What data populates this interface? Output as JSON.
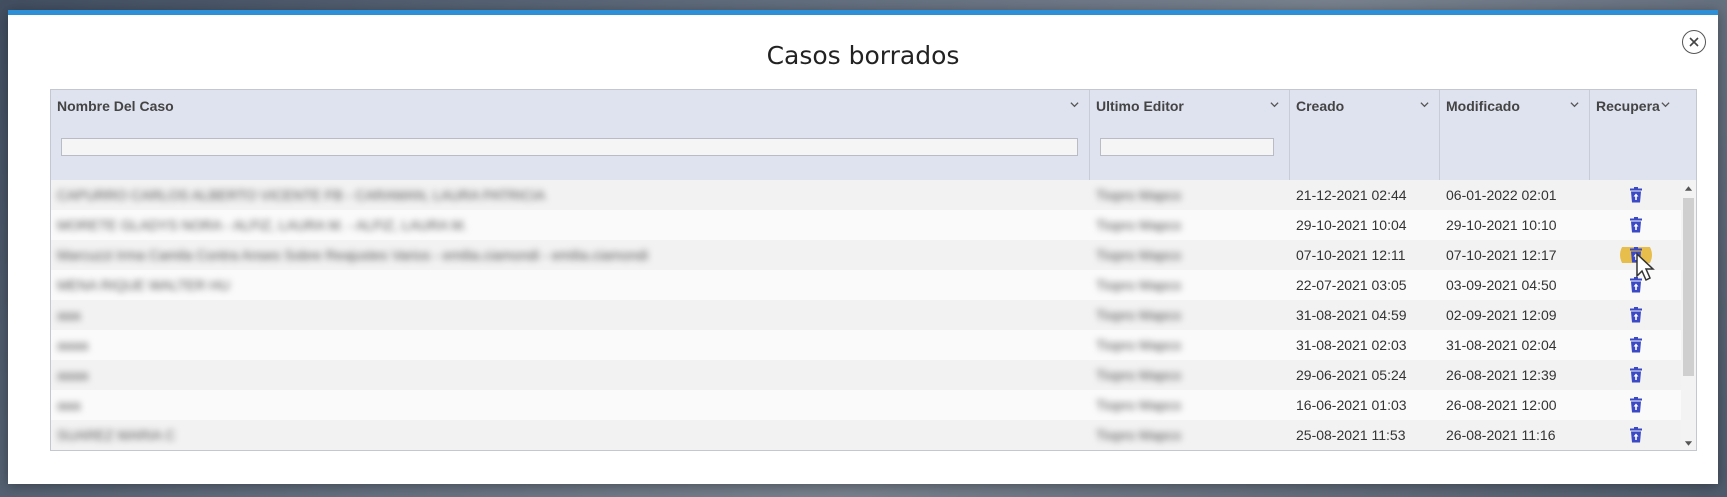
{
  "dialog": {
    "title": "Casos borrados"
  },
  "columns": [
    {
      "label": "Nombre Del Caso",
      "filter": ""
    },
    {
      "label": "Ultimo Editor",
      "filter": ""
    },
    {
      "label": "Creado"
    },
    {
      "label": "Modificado"
    },
    {
      "label": "Recupera"
    }
  ],
  "accent_color": "#2f8fd6",
  "restore_icon_color": "#3b49c4",
  "rows": [
    {
      "name": "CAPURRO CARLOS ALBERTO VICENTE FB - CARAMAN, LAURA PATRICIA",
      "editor": "Tiopro Mapco",
      "created": "21-12-2021 02:44",
      "modified": "06-01-2022 02:01",
      "hover": false
    },
    {
      "name": "MORETE GLADYS NORA - ALFIZ, LAURA M. - ALFIZ, LAURA M.",
      "editor": "Tiopro Mapco",
      "created": "29-10-2021 10:04",
      "modified": "29-10-2021 10:10",
      "hover": false
    },
    {
      "name": "Marcuzzi Irma Camila Contra Anses Sobre Reajustes Varios - emilia.ciamondi - emilia.ciamondi",
      "editor": "Tiopro Mapco",
      "created": "07-10-2021 12:11",
      "modified": "07-10-2021 12:17",
      "hover": true
    },
    {
      "name": "MENA RIQUE WALTER HU",
      "editor": "Tiopro Mapco",
      "created": "22-07-2021 03:05",
      "modified": "03-09-2021 04:50",
      "hover": false
    },
    {
      "name": "aaa",
      "editor": "Tiopro Mapco",
      "created": "31-08-2021 04:59",
      "modified": "02-09-2021 12:09",
      "hover": false
    },
    {
      "name": "aaaa",
      "editor": "Tiopro Mapco",
      "created": "31-08-2021 02:03",
      "modified": "31-08-2021 02:04",
      "hover": false
    },
    {
      "name": "aaaa",
      "editor": "Tiopro Mapco",
      "created": "29-06-2021 05:24",
      "modified": "26-08-2021 12:39",
      "hover": false
    },
    {
      "name": "aaa",
      "editor": "Tiopro Mapco",
      "created": "16-06-2021 01:03",
      "modified": "26-08-2021 12:00",
      "hover": false
    },
    {
      "name": "SUAREZ MARIA C",
      "editor": "Tiopro Mapco",
      "created": "25-08-2021 11:53",
      "modified": "26-08-2021 11:16",
      "hover": false
    }
  ]
}
